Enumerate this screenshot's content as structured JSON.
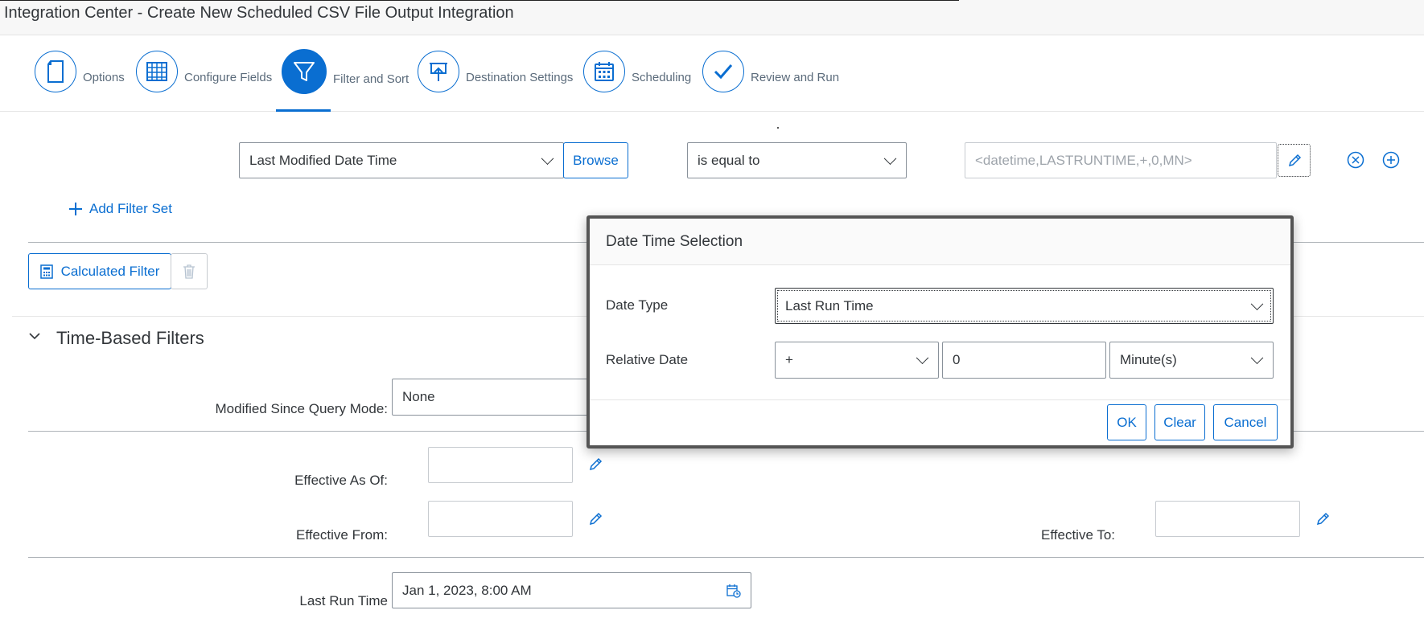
{
  "window": {
    "title": "Integration Center - Create New Scheduled CSV File Output Integration"
  },
  "steps": [
    {
      "label": "Options",
      "icon": "document-icon"
    },
    {
      "label": "Configure Fields",
      "icon": "grid-icon"
    },
    {
      "label": "Filter and Sort",
      "icon": "funnel-icon",
      "active": true
    },
    {
      "label": "Destination Settings",
      "icon": "upload-icon"
    },
    {
      "label": "Scheduling",
      "icon": "calendar-icon"
    },
    {
      "label": "Review and Run",
      "icon": "checkmark-icon"
    }
  ],
  "filter_row": {
    "field": "Last Modified Date Time",
    "browse": "Browse",
    "operator": "is equal to",
    "value_placeholder": "<datetime,LASTRUNTIME,+,0,MN>"
  },
  "add_filter_set": "Add Filter Set",
  "calculated_filter": "Calculated Filter",
  "time_filters": {
    "heading": "Time-Based Filters",
    "modified_since_label": "Modified Since Query Mode:",
    "modified_since_value": "None",
    "effective_as_of_label": "Effective As Of:",
    "effective_from_label": "Effective From:",
    "effective_to_label": "Effective To:",
    "last_run_label": "Last Run Time",
    "last_run_value": "Jan 1, 2023, 8:00 AM"
  },
  "dialog": {
    "title": "Date Time Selection",
    "date_type_label": "Date Type",
    "date_type_value": "Last Run Time",
    "relative_date_label": "Relative Date",
    "sign_value": "+",
    "amount_value": "0",
    "unit_value": "Minute(s)",
    "ok": "OK",
    "clear": "Clear",
    "cancel": "Cancel"
  },
  "colors": {
    "accent": "#0a6ed1",
    "text": "#32363a",
    "muted": "#5b6b7b"
  }
}
